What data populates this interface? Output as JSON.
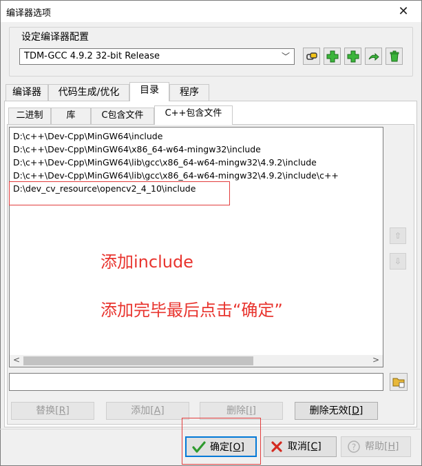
{
  "window": {
    "title": "编译器选项",
    "close": "✕"
  },
  "compiler_group": {
    "label": "设定编译器配置",
    "selected": "TDM-GCC 4.9.2 32-bit Release",
    "arrow": "﹀"
  },
  "main_tabs": [
    {
      "label": "编译器"
    },
    {
      "label": "代码生成/优化"
    },
    {
      "label": "目录"
    },
    {
      "label": "程序"
    }
  ],
  "sub_tabs": [
    {
      "label": "二进制"
    },
    {
      "label": "库"
    },
    {
      "label": "C包含文件"
    },
    {
      "label": "C++包含文件"
    }
  ],
  "include_dirs": [
    "D:\\c++\\Dev-Cpp\\MinGW64\\include",
    "D:\\c++\\Dev-Cpp\\MinGW64\\x86_64-w64-mingw32\\include",
    "D:\\c++\\Dev-Cpp\\MinGW64\\lib\\gcc\\x86_64-w64-mingw32\\4.9.2\\include",
    "D:\\c++\\Dev-Cpp\\MinGW64\\lib\\gcc\\x86_64-w64-mingw32\\4.9.2\\include\\c++",
    "D:\\dev_cv_resource\\opencv2_4_10\\include"
  ],
  "scroll": {
    "left": "<",
    "right": ">"
  },
  "side_buttons": {
    "up": "⇧",
    "down": "⇩"
  },
  "annotations": {
    "line1": "添加include",
    "line2": "添加完毕最后点击“确定”"
  },
  "actions": {
    "replace": "替换",
    "replace_key": "[R]",
    "add": "添加",
    "add_key": "[A]",
    "delete": "删除",
    "delete_key": "[I]",
    "delete_invalid": "删除无效",
    "delete_invalid_key": "[D]"
  },
  "dialog_buttons": {
    "ok": "确定",
    "ok_key": "[O]",
    "cancel": "取消",
    "cancel_key": "[C]",
    "help": "帮助",
    "help_key": "[H]"
  }
}
